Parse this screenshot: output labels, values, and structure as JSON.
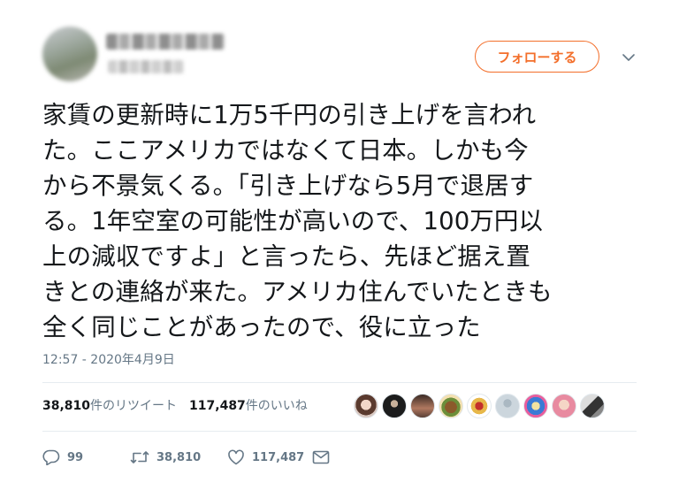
{
  "header": {
    "follow_label": "フォローする",
    "menu_icon": "chevron-down-icon"
  },
  "tweet": {
    "text_lines": [
      "家賃の更新時に1万5千円の引き上げを言われ",
      "た。ここアメリカではなくて日本。しかも今",
      "から不景気くる。「引き上げなら5月で退居す",
      "る。1年空室の可能性が高いので、100万円以",
      "上の減収ですよ」と言ったら、先ほど据え置",
      "きとの連絡が来た。アメリカ住んでいたときも",
      "全く同じことがあったので、役に立った"
    ],
    "timestamp": "12:57 - 2020年4月9日"
  },
  "stats": {
    "retweet_count": "38,810",
    "retweet_label": "件のリツイート",
    "like_count": "117,487",
    "like_label": "件のいいね"
  },
  "actions": {
    "reply_count": "99",
    "retweet_count": "38,810",
    "like_count": "117,487"
  },
  "colors": {
    "accent": "#f36f2b",
    "muted": "#657786",
    "text": "#14171a"
  }
}
